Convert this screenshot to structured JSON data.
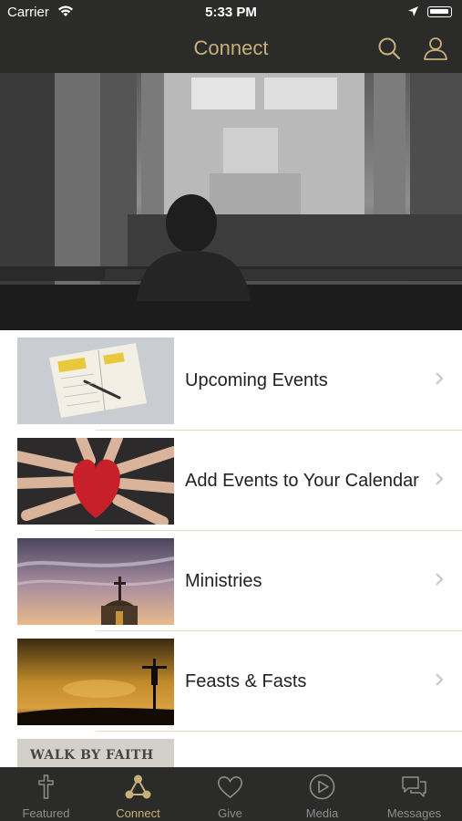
{
  "status_bar": {
    "carrier": "Carrier",
    "time": "5:33 PM"
  },
  "nav": {
    "title": "Connect",
    "search_icon": "search-icon",
    "profile_icon": "person-icon"
  },
  "colors": {
    "bar_bg": "#2b2b2a",
    "accent": "#c7b07a",
    "inactive": "#8e8e8e"
  },
  "items": [
    {
      "label": "Upcoming Events",
      "icon": "notebook-calendar-image"
    },
    {
      "label": "Add Events to Your Calendar",
      "icon": "red-heart-hands-image"
    },
    {
      "label": "Ministries",
      "icon": "church-cross-sky-image"
    },
    {
      "label": "Feasts & Fasts",
      "icon": "crucifix-sunset-image"
    },
    {
      "label": "",
      "image_text": "WALK BY FAITH",
      "icon": "walk-by-faith-image"
    }
  ],
  "tabs": [
    {
      "label": "Featured",
      "icon": "cross-icon",
      "active": false
    },
    {
      "label": "Connect",
      "icon": "connect-nodes-icon",
      "active": true
    },
    {
      "label": "Give",
      "icon": "heart-icon",
      "active": false
    },
    {
      "label": "Media",
      "icon": "play-circle-icon",
      "active": false
    },
    {
      "label": "Messages",
      "icon": "chat-bubbles-icon",
      "active": false
    }
  ]
}
